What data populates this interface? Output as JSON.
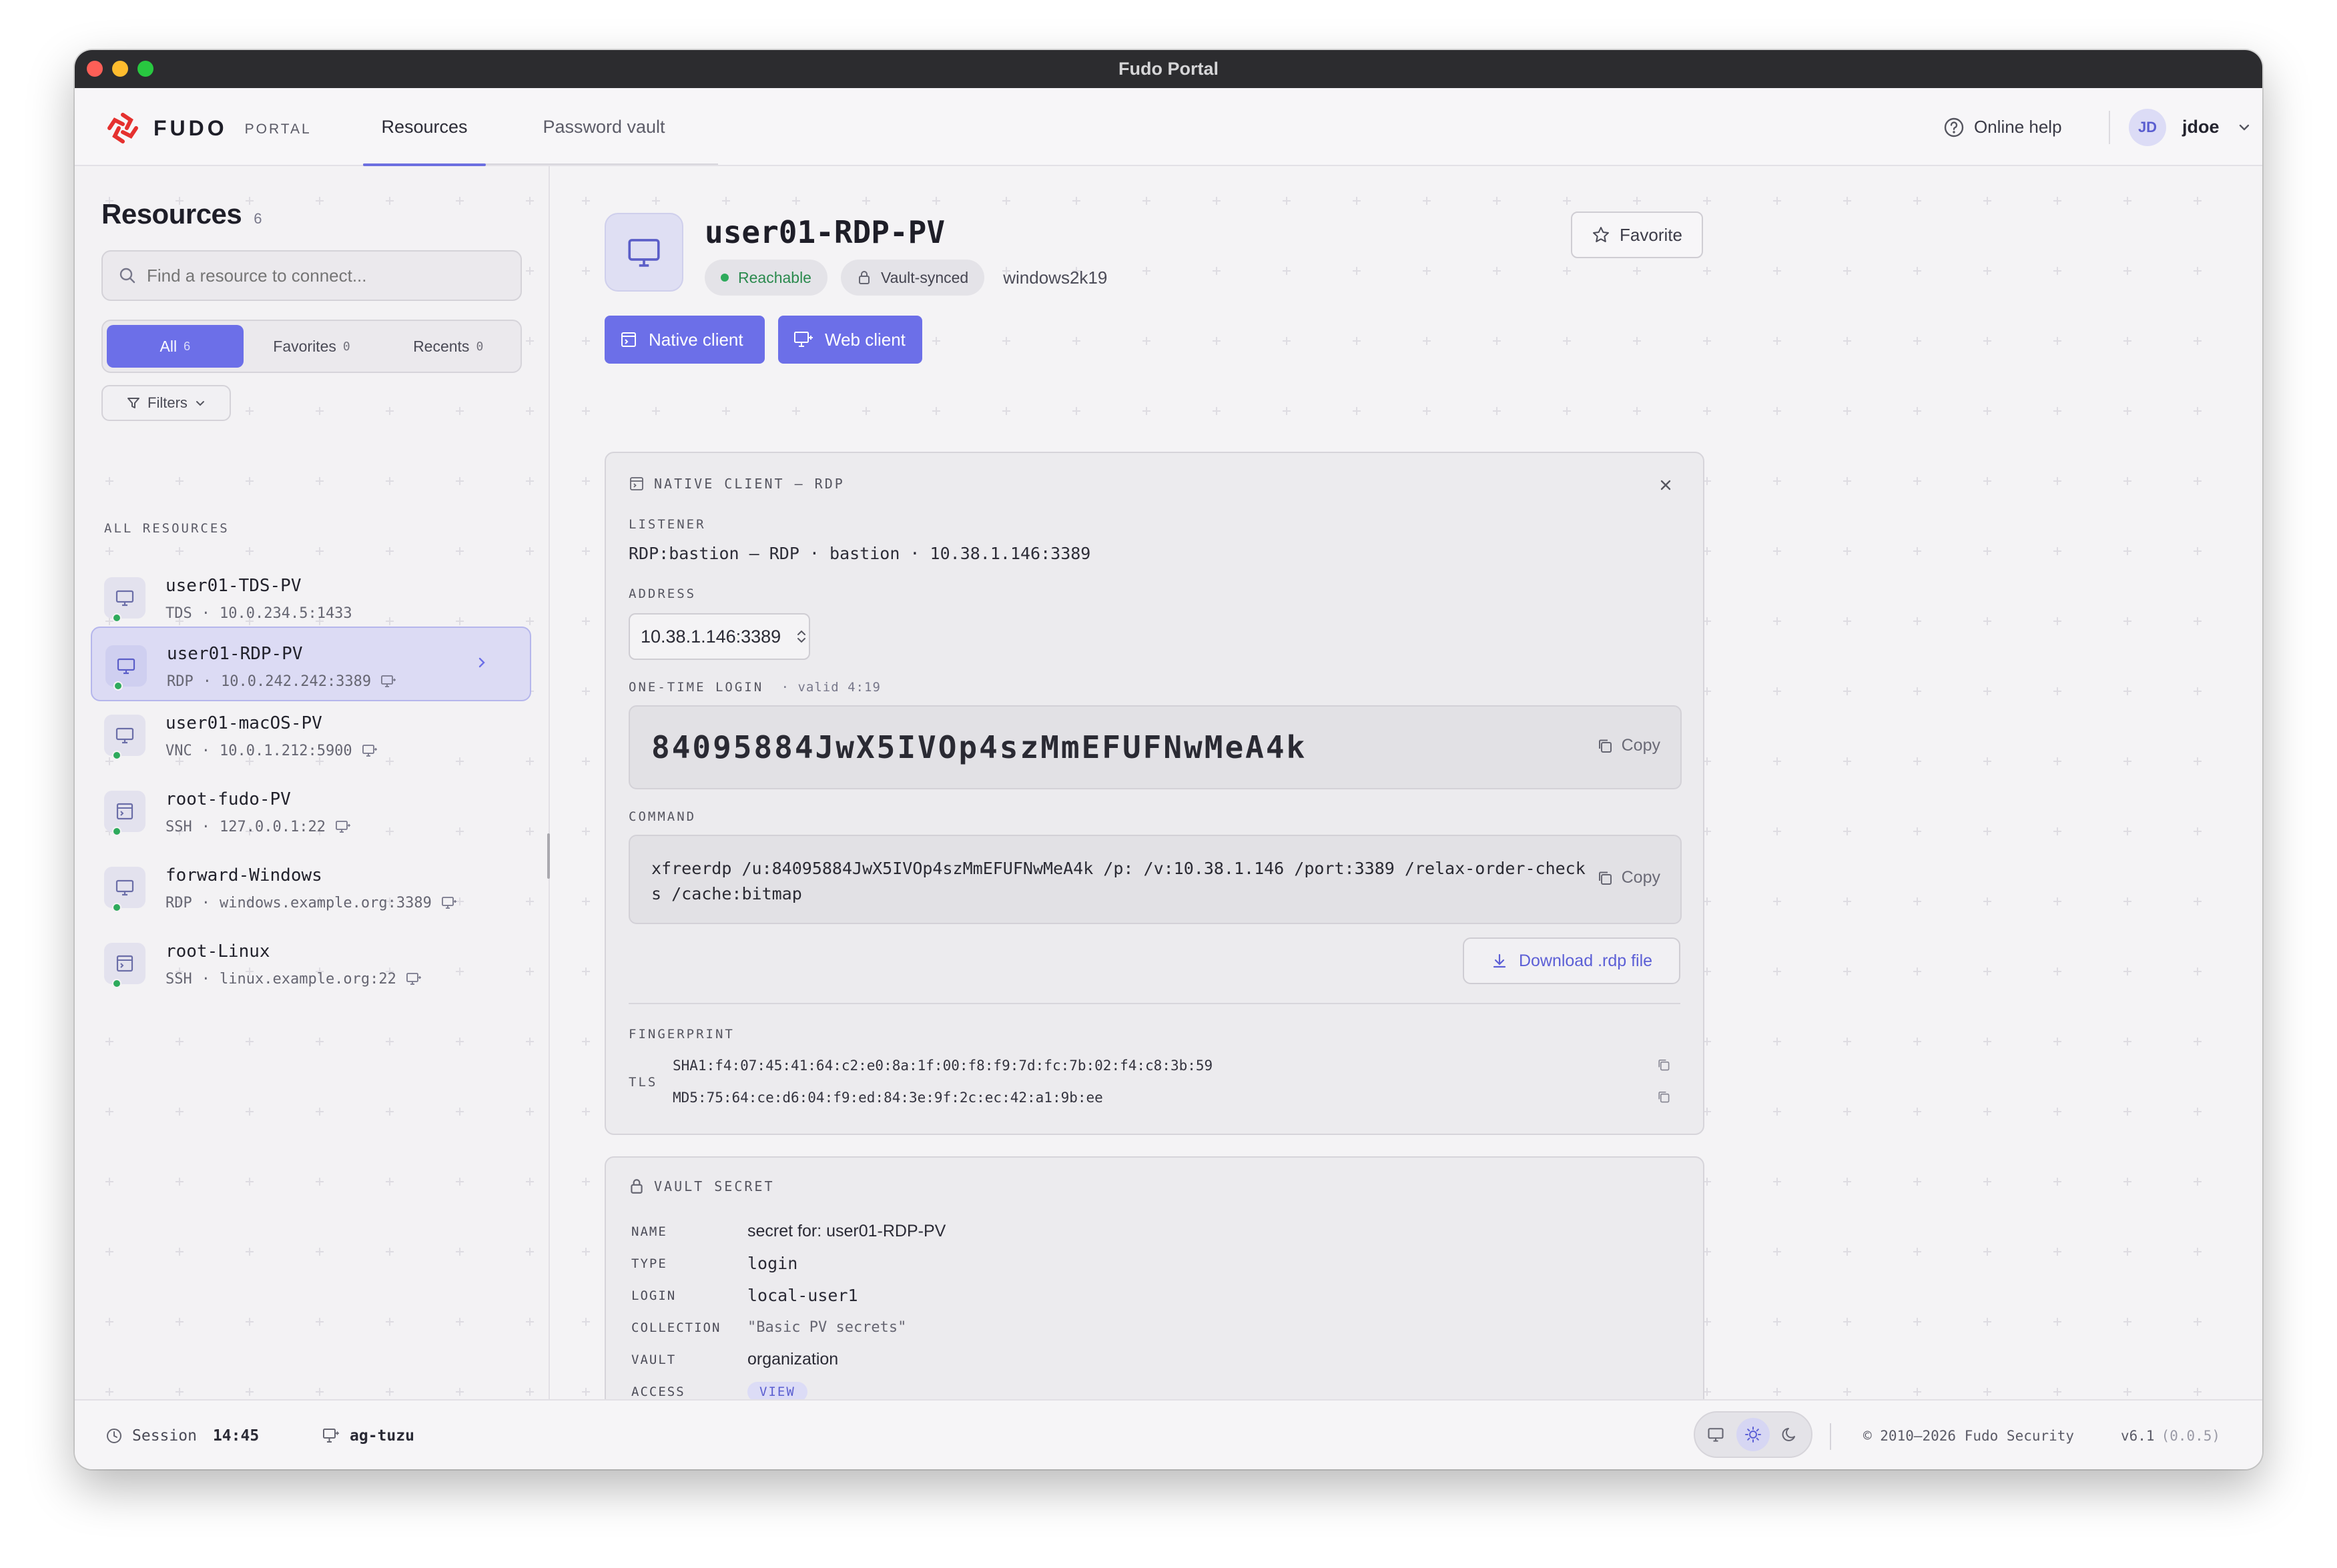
{
  "window": {
    "title": "Fudo Portal"
  },
  "header": {
    "brand": "FUDO",
    "brand_sub": "PORTAL",
    "tabs": [
      {
        "label": "Resources",
        "active": true
      },
      {
        "label": "Password vault",
        "active": false
      }
    ],
    "help_label": "Online help",
    "user_initials": "JD",
    "user_name": "jdoe"
  },
  "sidebar": {
    "title": "Resources",
    "count": "6",
    "search_placeholder": "Find a resource to connect...",
    "segments": [
      {
        "label": "All",
        "count": "6",
        "active": true
      },
      {
        "label": "Favorites",
        "count": "0",
        "active": false
      },
      {
        "label": "Recents",
        "count": "0",
        "active": false
      }
    ],
    "filters_label": "Filters",
    "section_label": "ALL RESOURCES",
    "resources": [
      {
        "name": "user01-TDS-PV",
        "protocol": "TDS",
        "address": "10.0.234.5:1433",
        "icon": "monitor-icon",
        "web": false,
        "status": "online"
      },
      {
        "name": "user01-RDP-PV",
        "protocol": "RDP",
        "address": "10.0.242.242:3389",
        "icon": "monitor-icon",
        "web": true,
        "status": "online",
        "selected": true
      },
      {
        "name": "user01-macOS-PV",
        "protocol": "VNC",
        "address": "10.0.1.212:5900",
        "icon": "monitor-icon",
        "web": true,
        "status": "online"
      },
      {
        "name": "root-fudo-PV",
        "protocol": "SSH",
        "address": "127.0.0.1:22",
        "icon": "terminal-icon",
        "web": true,
        "status": "online"
      },
      {
        "name": "forward-Windows",
        "protocol": "RDP",
        "address": "windows.example.org:3389",
        "icon": "monitor-icon",
        "web": true,
        "status": "online"
      },
      {
        "name": "root-Linux",
        "protocol": "SSH",
        "address": "linux.example.org:22",
        "icon": "terminal-icon",
        "web": true,
        "status": "online"
      }
    ]
  },
  "detail": {
    "title": "user01-RDP-PV",
    "badges": {
      "reachable": "Reachable",
      "vault": "Vault-synced",
      "host": "windows2k19"
    },
    "favorite_label": "Favorite",
    "native_client_label": "Native client",
    "web_client_label": "Web client",
    "native": {
      "header": "NATIVE CLIENT — RDP",
      "listener_label": "LISTENER",
      "listener_value": "RDP:bastion — RDP · bastion · 10.38.1.146:3389",
      "address_label": "ADDRESS",
      "address_value": "10.38.1.146:3389",
      "otp_label": "ONE-TIME LOGIN",
      "otp_valid": "· valid 4:19",
      "otp_value": "84095884JwX5IVOp4szMmEFUFNwMeA4k",
      "copy_label": "Copy",
      "command_label": "COMMAND",
      "command_value": "xfreerdp /u:84095884JwX5IVOp4szMmEFUFNwMeA4k /p: /v:10.38.1.146 /port:3389 /relax-order-checks /cache:bitmap",
      "download_label": "Download .rdp file",
      "fingerprint_label": "FINGERPRINT",
      "fingerprint_kind": "TLS",
      "sha1": "SHA1:f4:07:45:41:64:c2:e0:8a:1f:00:f8:f9:7d:fc:7b:02:f4:c8:3b:59",
      "md5": "MD5:75:64:ce:d6:04:f9:ed:84:3e:9f:2c:ec:42:a1:9b:ee"
    },
    "vault": {
      "header": "VAULT SECRET",
      "rows": [
        {
          "key": "NAME",
          "value": "secret for: user01-RDP-PV"
        },
        {
          "key": "TYPE",
          "value": "login"
        },
        {
          "key": "LOGIN",
          "value": "local-user1"
        },
        {
          "key": "COLLECTION",
          "value": "\"Basic PV secrets\""
        },
        {
          "key": "VAULT",
          "value": "organization"
        },
        {
          "key": "ACCESS",
          "value": "VIEW"
        }
      ]
    }
  },
  "footer": {
    "session_label": "Session",
    "session_time": "14:45",
    "gateway": "ag-tuzu",
    "copyright": "© 2010–2026 Fudo Security",
    "version": "v6.1",
    "version_sub": "(0.0.5)"
  },
  "colors": {
    "accent": "#6c6fe8",
    "online": "#2eaa5c",
    "logo": "#e5312f"
  }
}
